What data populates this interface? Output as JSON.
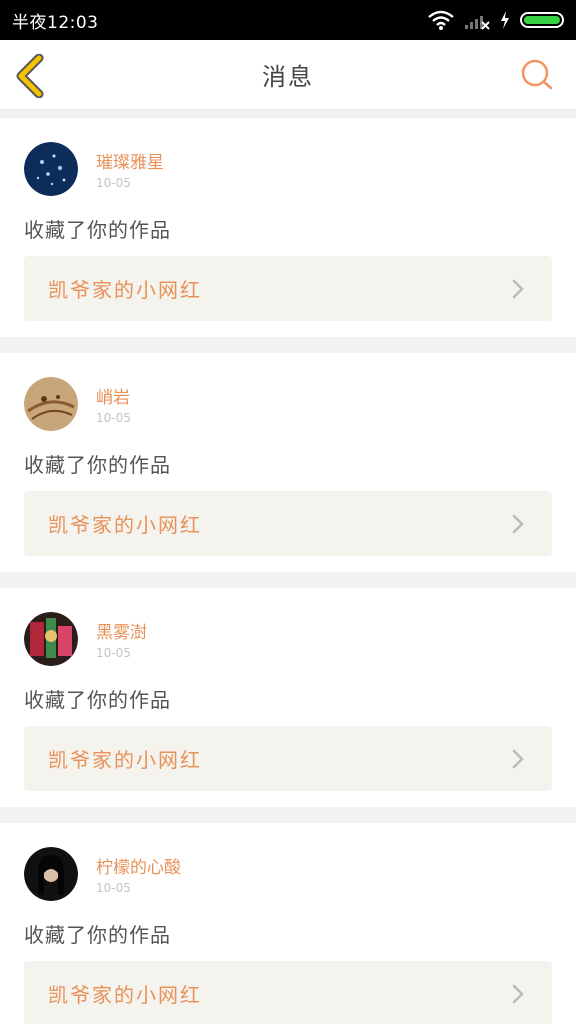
{
  "status_bar": {
    "time": "半夜12:03"
  },
  "header": {
    "title": "消息"
  },
  "messages": [
    {
      "username": "璀璨雅星",
      "date": "10-05",
      "action": "收藏了你的作品",
      "work_title": "凯爷家的小网红"
    },
    {
      "username": "峭岩",
      "date": "10-05",
      "action": "收藏了你的作品",
      "work_title": "凯爷家的小网红"
    },
    {
      "username": "黑雾澍",
      "date": "10-05",
      "action": "收藏了你的作品",
      "work_title": "凯爷家的小网红"
    },
    {
      "username": "柠檬的心酸",
      "date": "10-05",
      "action": "收藏了你的作品",
      "work_title": "凯爷家的小网红"
    }
  ],
  "colors": {
    "accent": "#e8925a",
    "back_arrow": "#f5c400",
    "battery": "#37d343"
  }
}
